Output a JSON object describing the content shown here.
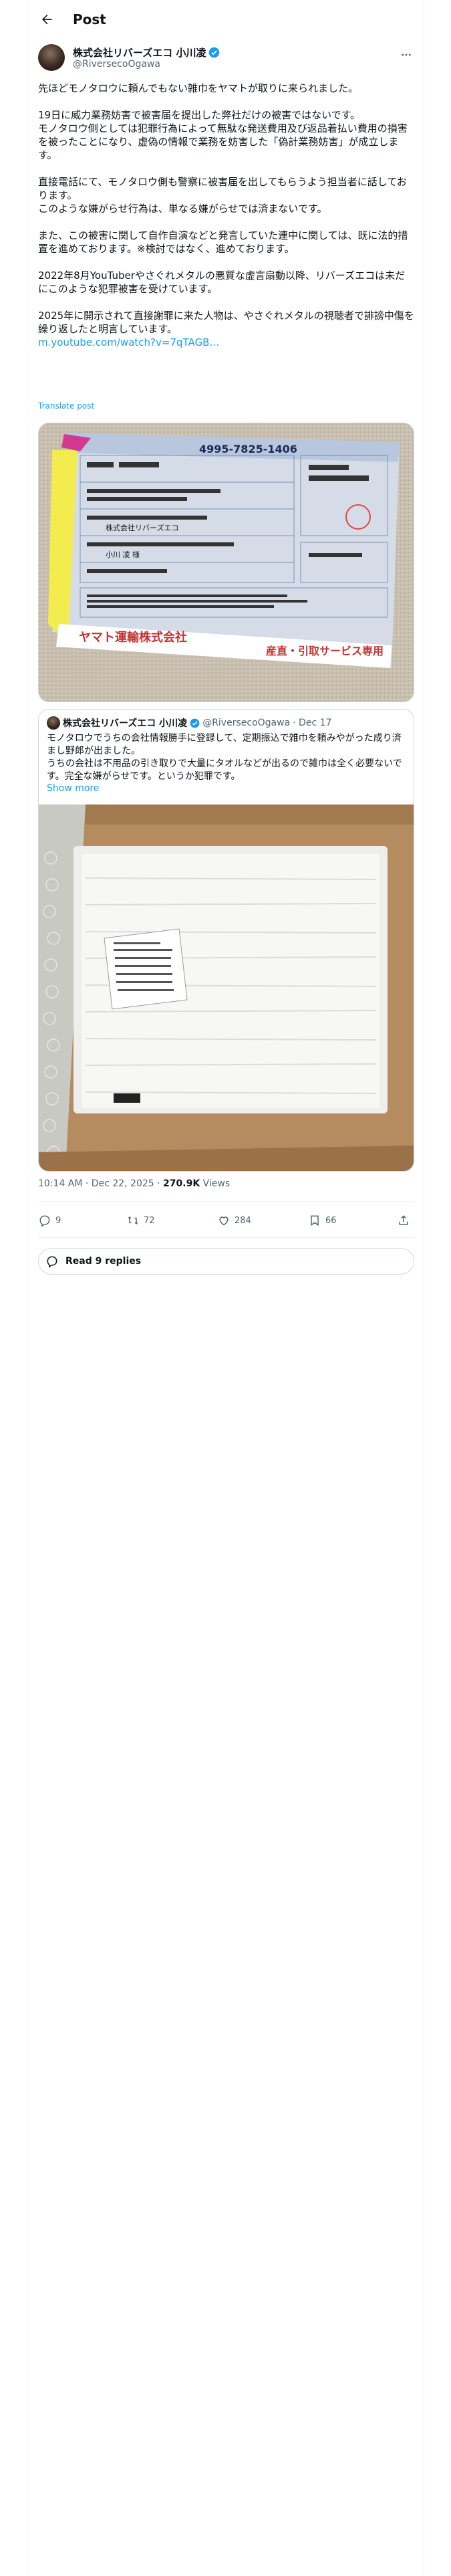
{
  "header": {
    "title": "Post"
  },
  "author": {
    "name": "株式会社リバーズエコ 小川凌",
    "handle": "@RiversecoOgawa"
  },
  "tweet": {
    "paragraphs": [
      [
        "先ほどモノタロウに頼んでもない雑巾をヤマトが取りに来られました。"
      ],
      [
        "19日に威力業務妨害で被害届を提出した弊社だけの被害ではないです。",
        "モノタロウ側としては犯罪行為によって無駄な発送費用及び返品着払い費用の損害を被ったことになり、虚偽の情報で業務を妨害した「偽計業務妨害」が成立します。"
      ],
      [
        "直接電話にて、モノタロウ側も警察に被害届を出してもらうよう担当者に話しております。",
        "このような嫌がらせ行為は、単なる嫌がらせでは済まないです。"
      ],
      [
        "また、この被害に関して自作自演などと発言していた連中に関しては、既に法的措置を進めております。※検討ではなく、進めております。"
      ],
      [
        "2022年8月YouTuberやさぐれメタルの悪質な虚言扇動以降、リバーズエコは未だにこのような犯罪被害を受けています。"
      ],
      [
        "2025年に開示されて直接謝罪に来た人物は、やさぐれメタルの視聴者で誹謗中傷を繰り返したと明言しています。"
      ]
    ],
    "link": "m.youtube.com/watch?v=7qTAGB…",
    "translate": "Translate post"
  },
  "label": {
    "tracking": "4995-7825-1406",
    "company": "ヤマト運輸株式会社",
    "service": "産直・引取サービス専用",
    "to_company": "株式会社リバーズエコ",
    "to_person": "小川 凌 様"
  },
  "quote": {
    "name": "株式会社リバーズエコ 小川凌",
    "handle": "@RiversecoOgawa",
    "date": "· Dec 17",
    "lines": [
      "モノタロウでうちの会社情報勝手に登録して、定期振込で雑巾を頼みやがった成り済まし野郎が出ました。",
      "うちの会社は不用品の引き取りで大量にタオルなどが出るので雑巾は全く必要ないです。完全な嫌がらせです。というか犯罪です。"
    ],
    "show_more": "Show more"
  },
  "meta": {
    "time": "10:14 AM · Dec 22, 2025 · ",
    "views_count": "270.9K",
    "views_label": " Views"
  },
  "actions": {
    "replies": "9",
    "reposts": "72",
    "likes": "284",
    "bookmarks": "66"
  },
  "read_replies": "Read 9 replies"
}
